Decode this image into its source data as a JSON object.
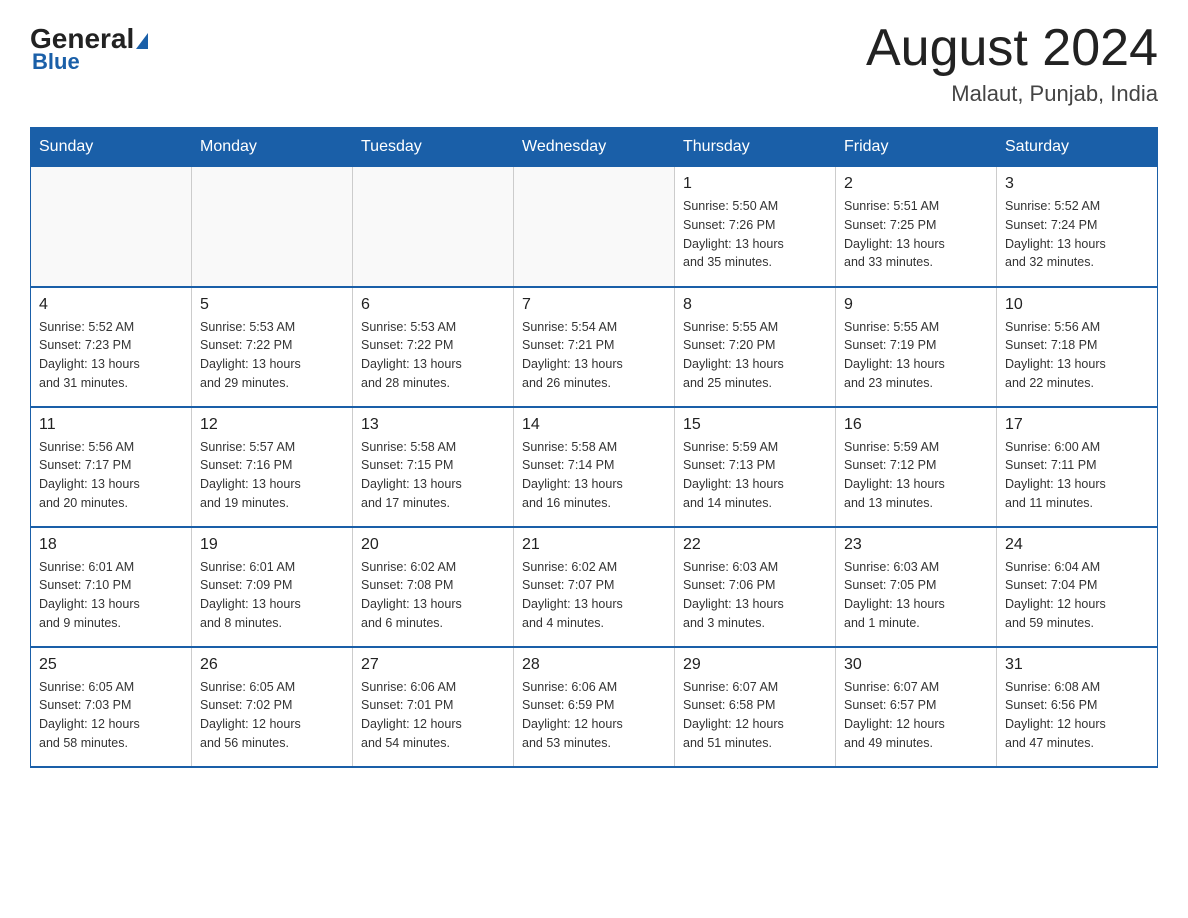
{
  "header": {
    "logo": {
      "general": "General",
      "blue": "Blue",
      "triangle": "▶"
    },
    "title": "August 2024",
    "location": "Malaut, Punjab, India"
  },
  "days_of_week": [
    "Sunday",
    "Monday",
    "Tuesday",
    "Wednesday",
    "Thursday",
    "Friday",
    "Saturday"
  ],
  "weeks": [
    {
      "cells": [
        {
          "day": "",
          "info": ""
        },
        {
          "day": "",
          "info": ""
        },
        {
          "day": "",
          "info": ""
        },
        {
          "day": "",
          "info": ""
        },
        {
          "day": "1",
          "info": "Sunrise: 5:50 AM\nSunset: 7:26 PM\nDaylight: 13 hours\nand 35 minutes."
        },
        {
          "day": "2",
          "info": "Sunrise: 5:51 AM\nSunset: 7:25 PM\nDaylight: 13 hours\nand 33 minutes."
        },
        {
          "day": "3",
          "info": "Sunrise: 5:52 AM\nSunset: 7:24 PM\nDaylight: 13 hours\nand 32 minutes."
        }
      ]
    },
    {
      "cells": [
        {
          "day": "4",
          "info": "Sunrise: 5:52 AM\nSunset: 7:23 PM\nDaylight: 13 hours\nand 31 minutes."
        },
        {
          "day": "5",
          "info": "Sunrise: 5:53 AM\nSunset: 7:22 PM\nDaylight: 13 hours\nand 29 minutes."
        },
        {
          "day": "6",
          "info": "Sunrise: 5:53 AM\nSunset: 7:22 PM\nDaylight: 13 hours\nand 28 minutes."
        },
        {
          "day": "7",
          "info": "Sunrise: 5:54 AM\nSunset: 7:21 PM\nDaylight: 13 hours\nand 26 minutes."
        },
        {
          "day": "8",
          "info": "Sunrise: 5:55 AM\nSunset: 7:20 PM\nDaylight: 13 hours\nand 25 minutes."
        },
        {
          "day": "9",
          "info": "Sunrise: 5:55 AM\nSunset: 7:19 PM\nDaylight: 13 hours\nand 23 minutes."
        },
        {
          "day": "10",
          "info": "Sunrise: 5:56 AM\nSunset: 7:18 PM\nDaylight: 13 hours\nand 22 minutes."
        }
      ]
    },
    {
      "cells": [
        {
          "day": "11",
          "info": "Sunrise: 5:56 AM\nSunset: 7:17 PM\nDaylight: 13 hours\nand 20 minutes."
        },
        {
          "day": "12",
          "info": "Sunrise: 5:57 AM\nSunset: 7:16 PM\nDaylight: 13 hours\nand 19 minutes."
        },
        {
          "day": "13",
          "info": "Sunrise: 5:58 AM\nSunset: 7:15 PM\nDaylight: 13 hours\nand 17 minutes."
        },
        {
          "day": "14",
          "info": "Sunrise: 5:58 AM\nSunset: 7:14 PM\nDaylight: 13 hours\nand 16 minutes."
        },
        {
          "day": "15",
          "info": "Sunrise: 5:59 AM\nSunset: 7:13 PM\nDaylight: 13 hours\nand 14 minutes."
        },
        {
          "day": "16",
          "info": "Sunrise: 5:59 AM\nSunset: 7:12 PM\nDaylight: 13 hours\nand 13 minutes."
        },
        {
          "day": "17",
          "info": "Sunrise: 6:00 AM\nSunset: 7:11 PM\nDaylight: 13 hours\nand 11 minutes."
        }
      ]
    },
    {
      "cells": [
        {
          "day": "18",
          "info": "Sunrise: 6:01 AM\nSunset: 7:10 PM\nDaylight: 13 hours\nand 9 minutes."
        },
        {
          "day": "19",
          "info": "Sunrise: 6:01 AM\nSunset: 7:09 PM\nDaylight: 13 hours\nand 8 minutes."
        },
        {
          "day": "20",
          "info": "Sunrise: 6:02 AM\nSunset: 7:08 PM\nDaylight: 13 hours\nand 6 minutes."
        },
        {
          "day": "21",
          "info": "Sunrise: 6:02 AM\nSunset: 7:07 PM\nDaylight: 13 hours\nand 4 minutes."
        },
        {
          "day": "22",
          "info": "Sunrise: 6:03 AM\nSunset: 7:06 PM\nDaylight: 13 hours\nand 3 minutes."
        },
        {
          "day": "23",
          "info": "Sunrise: 6:03 AM\nSunset: 7:05 PM\nDaylight: 13 hours\nand 1 minute."
        },
        {
          "day": "24",
          "info": "Sunrise: 6:04 AM\nSunset: 7:04 PM\nDaylight: 12 hours\nand 59 minutes."
        }
      ]
    },
    {
      "cells": [
        {
          "day": "25",
          "info": "Sunrise: 6:05 AM\nSunset: 7:03 PM\nDaylight: 12 hours\nand 58 minutes."
        },
        {
          "day": "26",
          "info": "Sunrise: 6:05 AM\nSunset: 7:02 PM\nDaylight: 12 hours\nand 56 minutes."
        },
        {
          "day": "27",
          "info": "Sunrise: 6:06 AM\nSunset: 7:01 PM\nDaylight: 12 hours\nand 54 minutes."
        },
        {
          "day": "28",
          "info": "Sunrise: 6:06 AM\nSunset: 6:59 PM\nDaylight: 12 hours\nand 53 minutes."
        },
        {
          "day": "29",
          "info": "Sunrise: 6:07 AM\nSunset: 6:58 PM\nDaylight: 12 hours\nand 51 minutes."
        },
        {
          "day": "30",
          "info": "Sunrise: 6:07 AM\nSunset: 6:57 PM\nDaylight: 12 hours\nand 49 minutes."
        },
        {
          "day": "31",
          "info": "Sunrise: 6:08 AM\nSunset: 6:56 PM\nDaylight: 12 hours\nand 47 minutes."
        }
      ]
    }
  ]
}
